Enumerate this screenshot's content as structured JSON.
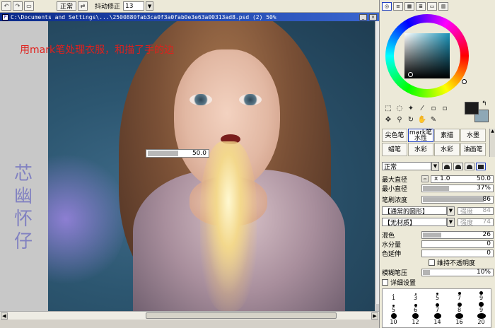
{
  "toolbar": {
    "mode": "正常",
    "stabilizer_label": "抖动修正",
    "stabilizer_value": "13",
    "undo_icon": "undo-icon",
    "redo_icon": "redo-icon"
  },
  "canvas_window": {
    "title": "C:\\Documents and Settings\\...\\2500880fab3ca0f3a0fab0e3e63a00313ad8.psd (2) 50%",
    "annotation": "用mark笔处理衣服，和描了手的边",
    "seal_text": "芯 幽 怀 仔",
    "brush_size_overlay": "50.0",
    "brush_size_fraction": 0.5
  },
  "panel": {
    "tabs": [
      "color-wheel",
      "sliders",
      "swatches",
      "history",
      "scratch",
      "layers"
    ],
    "fg_color": "#1c1c1c",
    "bg_color": "#8ea8b6",
    "brushes": [
      {
        "label": "尖色笔",
        "active": false
      },
      {
        "label": "mark笔 水性",
        "active": true
      },
      {
        "label": "素描",
        "active": false
      },
      {
        "label": "水墨",
        "active": false
      },
      {
        "label": "蜡笔",
        "active": false
      },
      {
        "label": "水彩",
        "active": false
      },
      {
        "label": "水彩",
        "active": false
      },
      {
        "label": "油画笔",
        "active": false
      }
    ],
    "blend_mode": "正常",
    "max_size_label": "最大直径",
    "max_size_mult": "x 1.0",
    "max_size_value": "50.0",
    "min_size_label": "最小直径",
    "min_size_value": "37%",
    "density_label": "笔刷浓度",
    "density_value": "86",
    "shape_select": "【通常的圆形】",
    "shape_strength_label": "强度",
    "shape_strength_value": "84",
    "texture_select": "【无材质】",
    "texture_strength_label": "强度",
    "texture_strength_value": "74",
    "blend_label": "混色",
    "blend_value": "26",
    "water_label": "水分量",
    "water_value": "0",
    "stretch_label": "色延伸",
    "stretch_value": "0",
    "keep_opacity_label": "维持不透明度",
    "blur_label": "模糊笔压",
    "blur_value": "10%",
    "detail_label": "详细设置",
    "dot_sizes": [
      "1",
      "3",
      "5",
      "7",
      "9",
      "5",
      "6",
      "7",
      "8",
      "9",
      "10",
      "12",
      "14",
      "16",
      "20"
    ]
  }
}
